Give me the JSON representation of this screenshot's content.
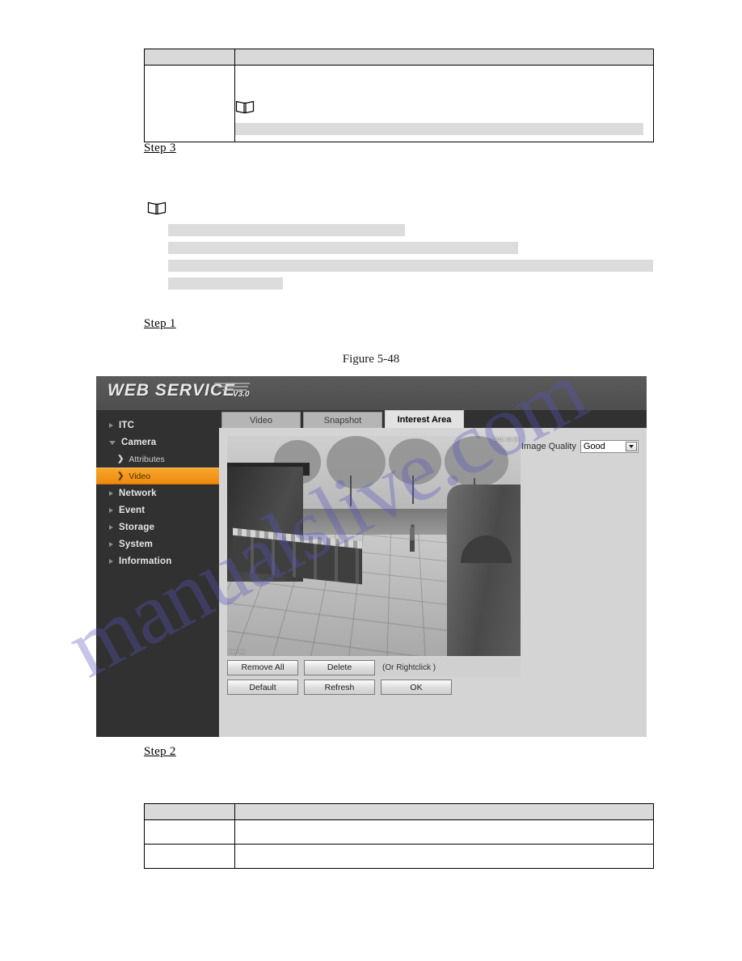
{
  "document": {
    "figure_caption": "Figure 5-48",
    "step_3": "Step 3",
    "step_1": "Step 1",
    "step_2": "Step 2",
    "watermark": "manualslive.com",
    "note_icon_name": "note-book-icon",
    "top_table": {
      "header": [
        "",
        ""
      ],
      "rows": [
        [
          "",
          ""
        ]
      ],
      "note_redacted_bar": ""
    },
    "note_block": {
      "lines": [
        "",
        "",
        "",
        ""
      ]
    },
    "bottom_table": {
      "header": [
        "",
        ""
      ],
      "rows": [
        [
          "",
          ""
        ],
        [
          "",
          ""
        ]
      ]
    }
  },
  "webui": {
    "logo": {
      "text": "WEB  SERVICE",
      "version": "V3.0"
    },
    "sidebar": {
      "items": [
        {
          "label": "ITC",
          "type": "group",
          "expanded": false,
          "active": false
        },
        {
          "label": "Camera",
          "type": "group",
          "expanded": true,
          "active": false
        },
        {
          "label": "Attributes",
          "type": "sub",
          "active": false
        },
        {
          "label": "Video",
          "type": "sub",
          "active": true
        },
        {
          "label": "Network",
          "type": "group",
          "expanded": false,
          "active": false
        },
        {
          "label": "Event",
          "type": "group",
          "expanded": false,
          "active": false
        },
        {
          "label": "Storage",
          "type": "group",
          "expanded": false,
          "active": false
        },
        {
          "label": "System",
          "type": "group",
          "expanded": false,
          "active": false
        },
        {
          "label": "Information",
          "type": "group",
          "expanded": false,
          "active": false
        }
      ]
    },
    "tabs": [
      {
        "label": "Video",
        "active": false
      },
      {
        "label": "Snapshot",
        "active": false
      },
      {
        "label": "Interest Area",
        "active": true
      }
    ],
    "quality": {
      "label": "Image Quality",
      "value": "Good"
    },
    "video": {
      "osd_top_right": "2016-10-09",
      "osd_bottom_left": "Dev 01"
    },
    "buttons": {
      "remove_all": "Remove All",
      "delete": "Delete",
      "hint": "(Or Rightclick )",
      "default": "Default",
      "refresh": "Refresh",
      "ok": "OK"
    },
    "colors": {
      "accent": "#ef8a10",
      "sidebar_bg": "#313131",
      "header_bg": "#555555",
      "panel_bg": "#d4d4d4"
    }
  }
}
